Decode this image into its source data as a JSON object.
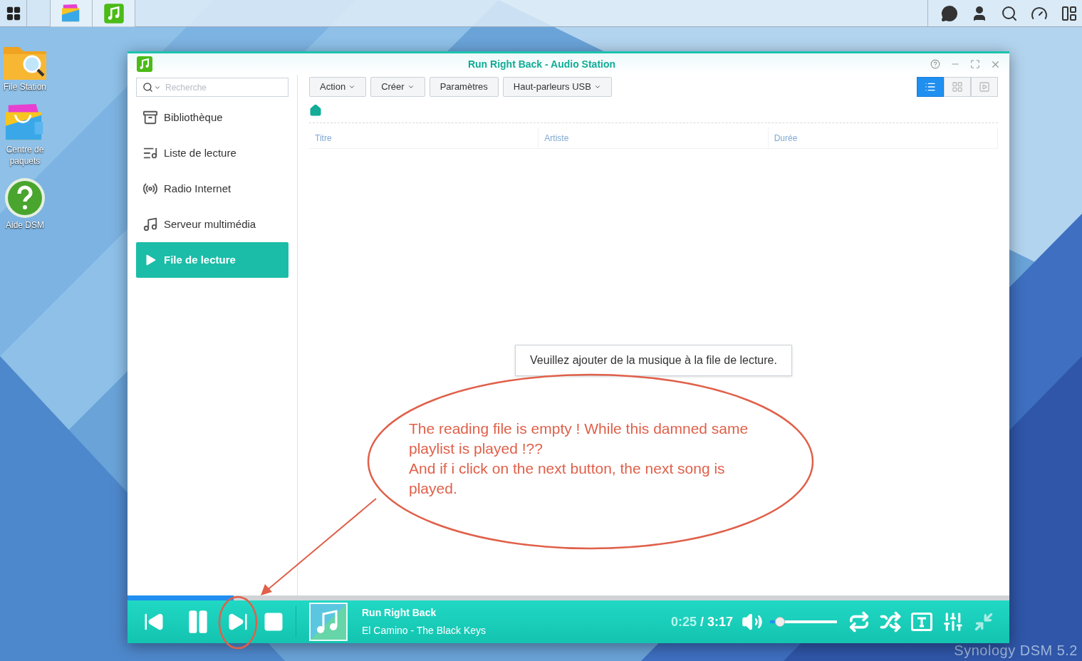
{
  "desktop_icons": [
    {
      "kind": "folder",
      "label": "File Station"
    },
    {
      "kind": "package",
      "label": "Centre de paquets"
    },
    {
      "kind": "help",
      "label": "Aide DSM"
    }
  ],
  "window": {
    "title": "Run Right Back - Audio Station"
  },
  "search": {
    "placeholder": "Recherche"
  },
  "sidebar": {
    "items": [
      {
        "kind": "library",
        "label": "Bibliothèque",
        "selected": false
      },
      {
        "kind": "playlist",
        "label": "Liste de lecture",
        "selected": false
      },
      {
        "kind": "radio",
        "label": "Radio Internet",
        "selected": false
      },
      {
        "kind": "server",
        "label": "Serveur multimédia",
        "selected": false
      },
      {
        "kind": "queue",
        "label": "File de lecture",
        "selected": true
      }
    ]
  },
  "toolbar": {
    "buttons": [
      {
        "label": "Action",
        "dropdown": true
      },
      {
        "label": "Créer",
        "dropdown": true
      },
      {
        "label": "Paramètres",
        "dropdown": false
      },
      {
        "label": "Haut-parleurs USB",
        "dropdown": true
      }
    ]
  },
  "view_modes": [
    {
      "kind": "list",
      "selected": true
    },
    {
      "kind": "grid",
      "selected": false
    },
    {
      "kind": "cover",
      "selected": false
    }
  ],
  "table": {
    "columns": [
      "Titre",
      "Artiste",
      "Durée"
    ]
  },
  "empty_message": "Veuillez ajouter de la musique à la file de lecture.",
  "player": {
    "progress": {
      "level": 0.12
    },
    "title": "Run Right Back",
    "subtitle": "El Camino - The Black Keys",
    "elapsed": "0:25",
    "total": "/ 3:17",
    "volume": {
      "level": 0.15
    }
  },
  "annotation": {
    "text": "The reading file is empty ! While this damned same playlist is played !??\nAnd if i click on the next button, the next song is played."
  },
  "desktop_branding": "Synology DSM 5.2"
}
